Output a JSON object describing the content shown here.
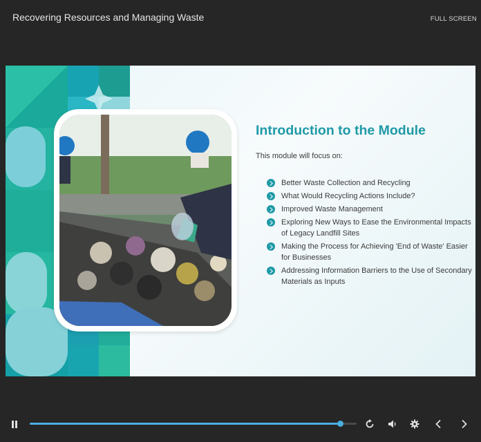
{
  "header": {
    "title": "Recovering Resources and Managing Waste",
    "fullscreen_label": "FULL SCREEN"
  },
  "slide": {
    "title": "Introduction to the Module",
    "intro": "This module will focus on:",
    "topics": [
      "Better Waste Collection and Recycling",
      "What Would Recycling Actions Include?",
      "Improved Waste Management",
      "Exploring New Ways to Ease the Environmental Impacts of Legacy Landfill Sites",
      "Making the Process for Achieving 'End of Waste' Easier for Businesses",
      "Addressing Information Barriers to the Use of Secondary Materials as Inputs"
    ],
    "accent_color": "#1f9aa7"
  },
  "player": {
    "progress": 0.95,
    "progress_color": "#4aaee0",
    "icons": [
      "pause-icon",
      "replay-icon",
      "volume-icon",
      "settings-icon",
      "previous-icon",
      "next-icon"
    ]
  }
}
